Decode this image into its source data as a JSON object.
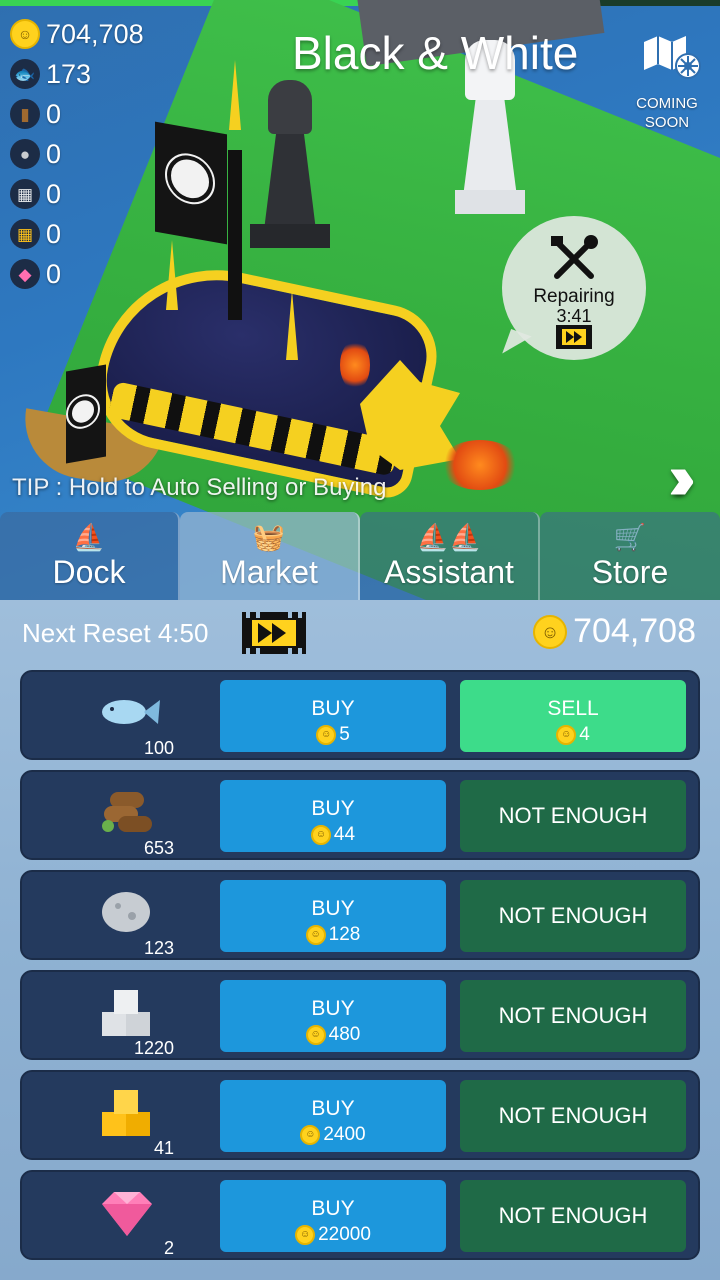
{
  "hud": {
    "coins": "704,708",
    "fish": "173",
    "wood": "0",
    "stone": "0",
    "silver": "0",
    "gold": "0",
    "gem": "0"
  },
  "location": {
    "title": "Black & White",
    "coming_soon": "COMING\nSOON"
  },
  "repair": {
    "label": "Repairing",
    "time": "3:41"
  },
  "tip": "TIP : Hold to Auto Selling or Buying",
  "tabs": [
    {
      "label": "Dock",
      "icon": "boat-icon",
      "active": false
    },
    {
      "label": "Market",
      "icon": "basket-icon",
      "active": true
    },
    {
      "label": "Assistant",
      "icon": "boats-icon",
      "active": false
    },
    {
      "label": "Store",
      "icon": "store-basket-icon",
      "active": false
    }
  ],
  "market": {
    "reset_label": "Next Reset",
    "reset_time": "4:50",
    "wallet": "704,708",
    "items": [
      {
        "name": "fish",
        "qty": "100",
        "buy_label": "BUY",
        "buy_price": "5",
        "action": "sell",
        "sell_label": "SELL",
        "sell_price": "4"
      },
      {
        "name": "wood",
        "qty": "653",
        "buy_label": "BUY",
        "buy_price": "44",
        "action": "none",
        "none_label": "NOT ENOUGH"
      },
      {
        "name": "stone",
        "qty": "123",
        "buy_label": "BUY",
        "buy_price": "128",
        "action": "none",
        "none_label": "NOT ENOUGH"
      },
      {
        "name": "silver",
        "qty": "1220",
        "buy_label": "BUY",
        "buy_price": "480",
        "action": "none",
        "none_label": "NOT ENOUGH"
      },
      {
        "name": "gold",
        "qty": "41",
        "buy_label": "BUY",
        "buy_price": "2400",
        "action": "none",
        "none_label": "NOT ENOUGH"
      },
      {
        "name": "gem",
        "qty": "2",
        "buy_label": "BUY",
        "buy_price": "22000",
        "action": "none",
        "none_label": "NOT ENOUGH"
      }
    ]
  },
  "colors": {
    "buy": "#1d97dc",
    "sell": "#3ddc8a",
    "not_enough": "#1f6a47",
    "row_bg": "#243a5e",
    "coin": "#ffd21e"
  }
}
